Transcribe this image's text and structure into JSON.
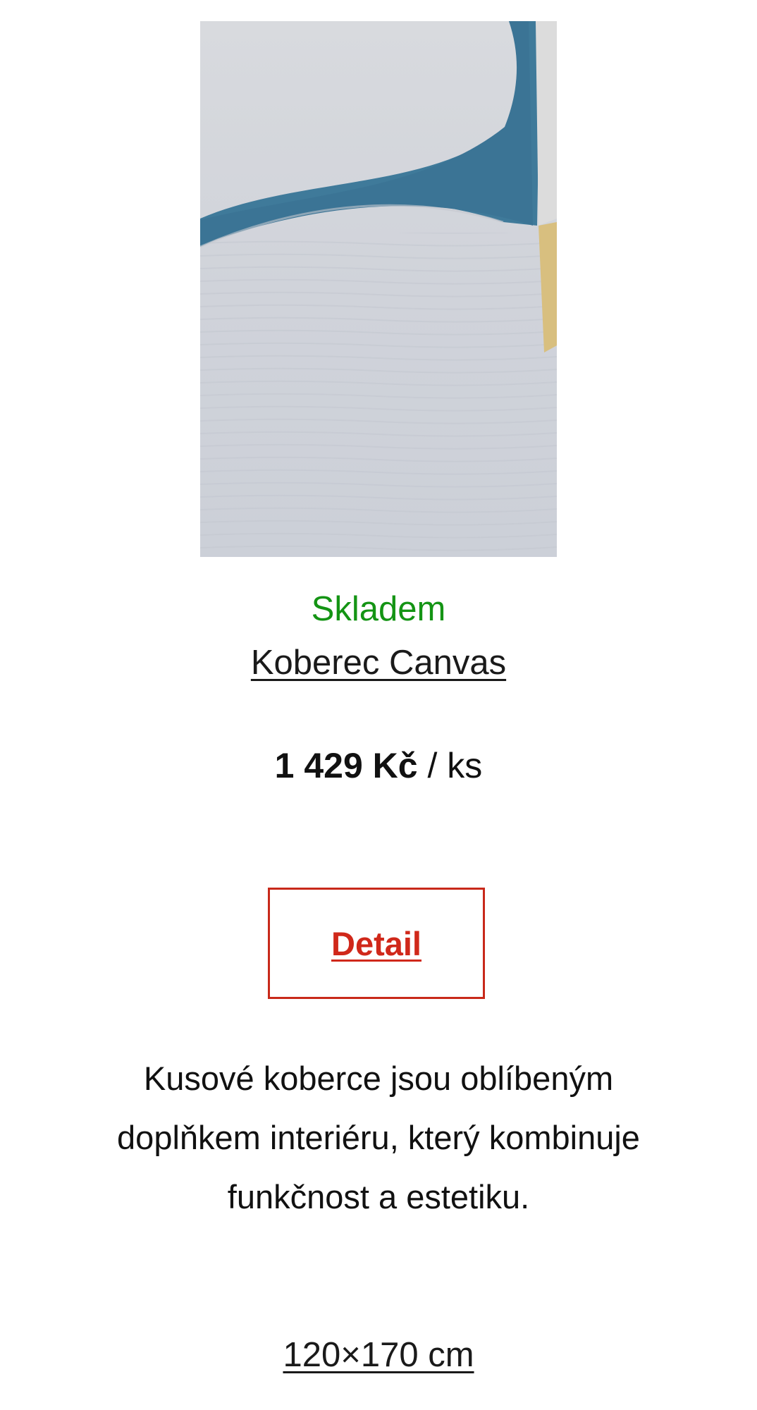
{
  "product": {
    "image_icon": "carpet-photo",
    "stock_status": "Skladem",
    "stock_color": "#149414",
    "name": "Koberec Canvas",
    "price": {
      "amount": "1 429 Kč",
      "unit": "/ ks"
    },
    "detail_label": "Detail",
    "accent_color": "#d0281a",
    "description": "Kusové koberce jsou oblíbeným doplňkem interiéru, který kombinuje funkčnost a estetiku.",
    "size": "120×170 cm"
  }
}
